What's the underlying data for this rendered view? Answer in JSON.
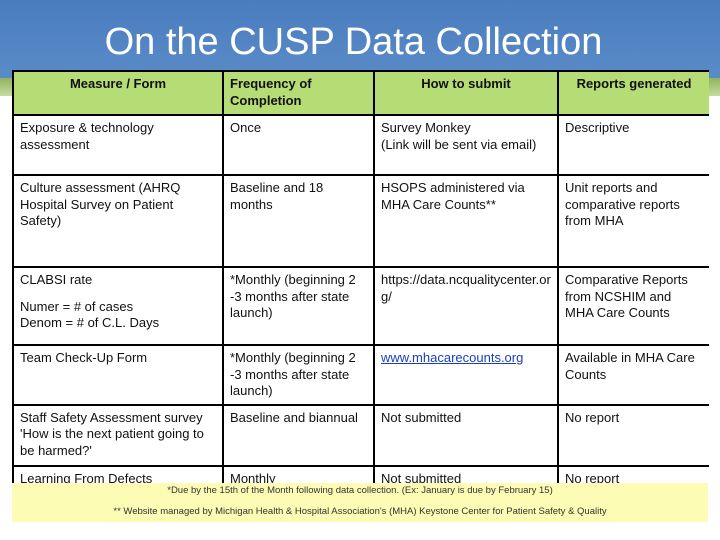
{
  "title": "On the CUSP Data Collection",
  "table": {
    "headers": [
      "Measure / Form",
      "Frequency of Completion",
      "How to submit",
      "Reports generated"
    ],
    "rows": [
      {
        "measure": "Exposure  & technology assessment",
        "frequency": "Once",
        "submit": "Survey Monkey",
        "submit2": "(Link will be sent via email)",
        "reports": "Descriptive"
      },
      {
        "measure": "Culture assessment (AHRQ Hospital Survey on Patient Safety)",
        "frequency": "Baseline and 18 months",
        "submit": "HSOPS administered via MHA Care Counts**",
        "reports": "Unit reports and comparative reports from MHA"
      },
      {
        "measure": "CLABSI rate",
        "measure_sub1": "Numer = # of cases",
        "measure_sub2": "Denom = # of C.L. Days",
        "frequency": "*Monthly (beginning 2 -3 months after state launch)",
        "submit": "https://data.ncqualitycenter.org/",
        "reports": "Comparative  Reports from NCSHIM and MHA Care Counts"
      },
      {
        "measure": "Team Check-Up Form",
        "frequency": "*Monthly (beginning 2 -3 months after state launch)",
        "submit": "www.mhacarecounts.org",
        "reports": "Available in MHA Care Counts"
      },
      {
        "measure": "Staff Safety Assessment survey 'How is the next patient going to be harmed?'",
        "frequency": "Baseline and biannual",
        "submit": "Not submitted",
        "reports": "No report"
      },
      {
        "measure": "Learning From Defects",
        "frequency": "Monthly",
        "submit": "Not submitted",
        "reports": "No report"
      }
    ]
  },
  "footnotes": [
    "*Due by the 15th of the Month following data collection.  (Ex: January is due by February 15)",
    "** Website managed by Michigan Health & Hospital Association's (MHA) Keystone Center for Patient Safety & Quality"
  ],
  "colors": {
    "header_bg": "#b5dc75",
    "title_band": "#4a7dbf",
    "footnote_bg": "#fcfcb4"
  }
}
